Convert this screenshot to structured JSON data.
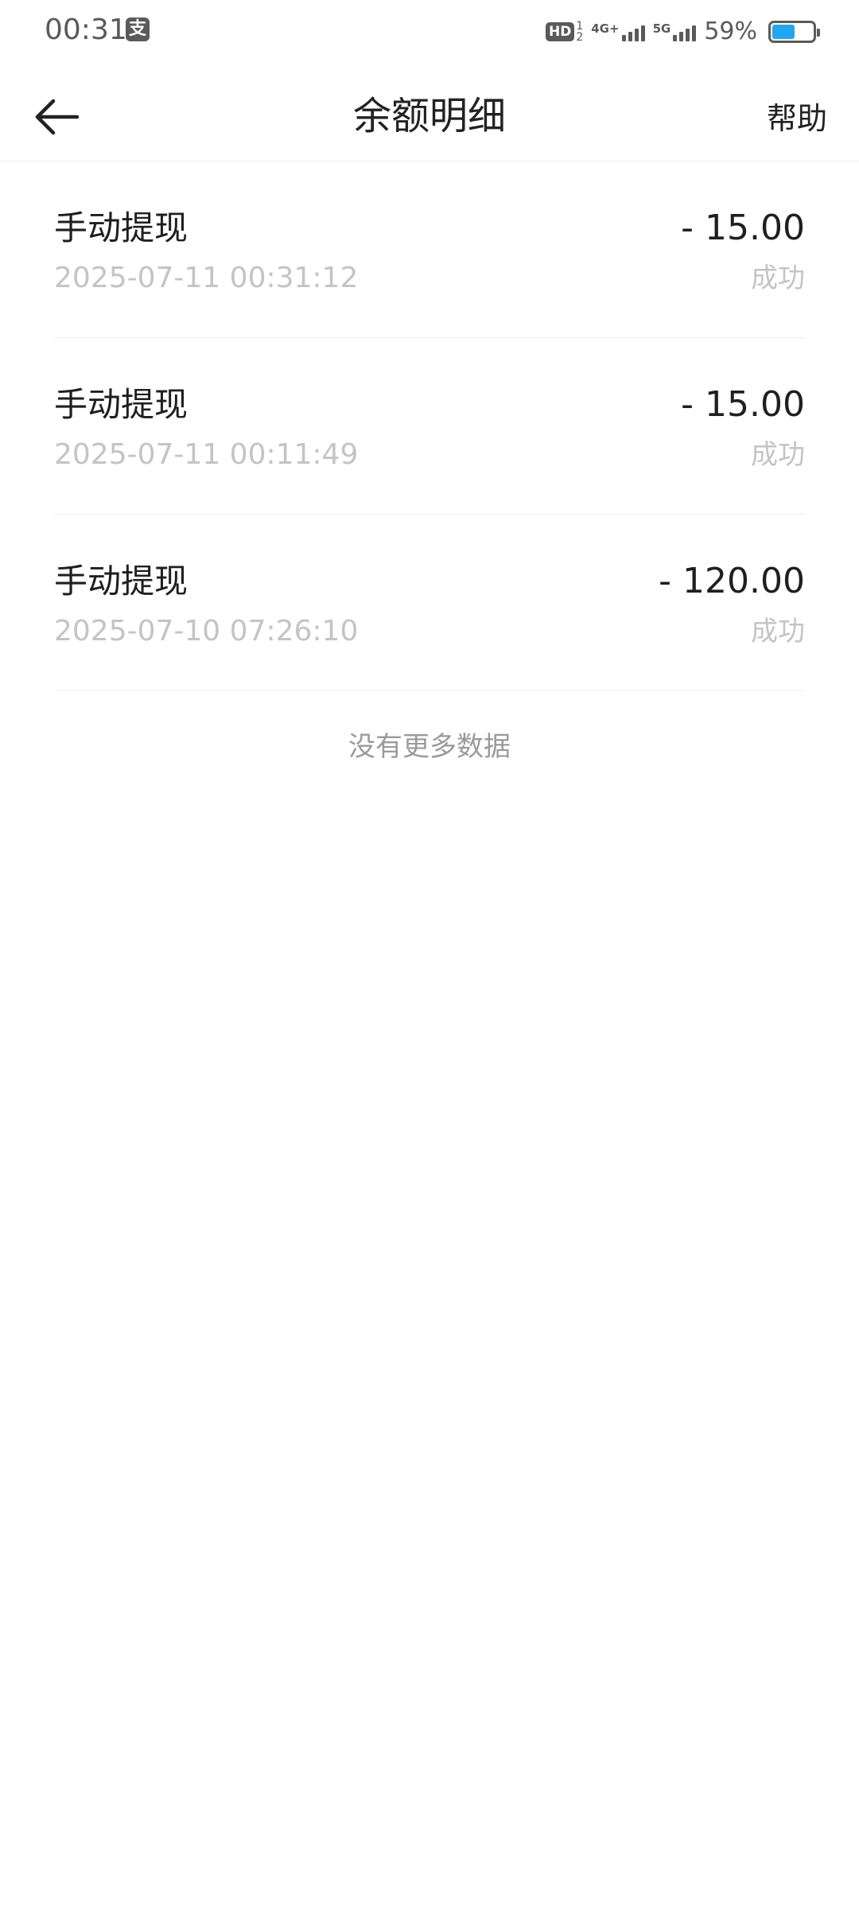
{
  "status_bar": {
    "time": "00:31",
    "app_icon_glyph": "支",
    "hd_label": "HD",
    "hd_sub": [
      "1",
      "2"
    ],
    "network_1": "4G+",
    "network_2": "5G",
    "battery_percent_text": "59%",
    "battery_level": 0.59,
    "battery_color": "#23a6f0"
  },
  "nav": {
    "back_icon": "arrow-left-icon",
    "title": "余额明细",
    "help_label": "帮助"
  },
  "records": [
    {
      "title": "手动提现",
      "amount": "- 15.00",
      "time": "2025-07-11 00:31:12",
      "status": "成功"
    },
    {
      "title": "手动提现",
      "amount": "- 15.00",
      "time": "2025-07-11 00:11:49",
      "status": "成功"
    },
    {
      "title": "手动提现",
      "amount": "- 120.00",
      "time": "2025-07-10 07:26:10",
      "status": "成功"
    }
  ],
  "footer": {
    "no_more_text": "没有更多数据"
  }
}
